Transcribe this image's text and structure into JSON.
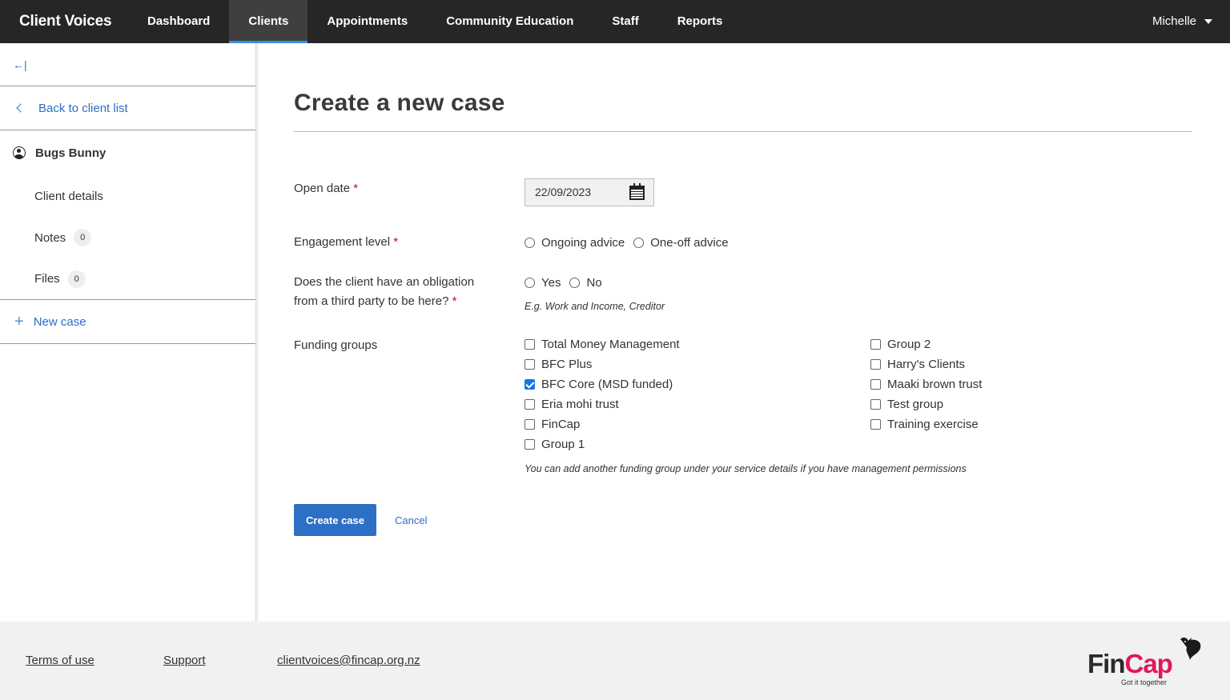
{
  "app": {
    "brand": "Client Voices"
  },
  "nav": {
    "items": [
      {
        "label": "Dashboard",
        "active": false
      },
      {
        "label": "Clients",
        "active": true
      },
      {
        "label": "Appointments",
        "active": false
      },
      {
        "label": "Community Education",
        "active": false
      },
      {
        "label": "Staff",
        "active": false
      },
      {
        "label": "Reports",
        "active": false
      }
    ],
    "user": "Michelle"
  },
  "sidebar": {
    "collapse_glyph": "←|",
    "back_label": "Back to client list",
    "client_name": "Bugs Bunny",
    "items": [
      {
        "label": "Client details"
      },
      {
        "label": "Notes",
        "count": "0"
      },
      {
        "label": "Files",
        "count": "0"
      }
    ],
    "new_case_label": "New case"
  },
  "form": {
    "title": "Create a new case",
    "open_date": {
      "label": "Open date",
      "required_mark": "*",
      "value": "22/09/2023"
    },
    "engagement": {
      "label": "Engagement level",
      "required_mark": "*",
      "options": [
        "Ongoing advice",
        "One-off advice"
      ],
      "selected": null
    },
    "obligation": {
      "label_line1": "Does the client have an obligation",
      "label_line2": "from a third party to be here?",
      "required_mark": "*",
      "options": [
        "Yes",
        "No"
      ],
      "hint": "E.g. Work and Income, Creditor"
    },
    "funding": {
      "label": "Funding groups",
      "col1": [
        {
          "label": "Total Money Management",
          "checked": false
        },
        {
          "label": "BFC Plus",
          "checked": false
        },
        {
          "label": "BFC Core (MSD funded)",
          "checked": true
        },
        {
          "label": "Eria mohi trust",
          "checked": false
        },
        {
          "label": "FinCap",
          "checked": false
        },
        {
          "label": "Group 1",
          "checked": false
        }
      ],
      "col2": [
        {
          "label": "Group 2",
          "checked": false
        },
        {
          "label": "Harry's Clients",
          "checked": false
        },
        {
          "label": "Maaki brown trust",
          "checked": false
        },
        {
          "label": "Test group",
          "checked": false
        },
        {
          "label": "Training exercise",
          "checked": false
        }
      ],
      "hint": "You can add another funding group under your service details if you have management permissions"
    },
    "create_label": "Create case",
    "cancel_label": "Cancel"
  },
  "footer": {
    "terms": "Terms of use",
    "support": "Support",
    "email": "clientvoices@fincap.org.nz",
    "logo_fin": "Fin",
    "logo_cap": "Cap",
    "logo_tagline": "Got it together"
  },
  "colors": {
    "accent": "#2d6fc4",
    "nav_bg": "#262626",
    "required": "#d0021b",
    "brand_pink": "#e0185a"
  }
}
